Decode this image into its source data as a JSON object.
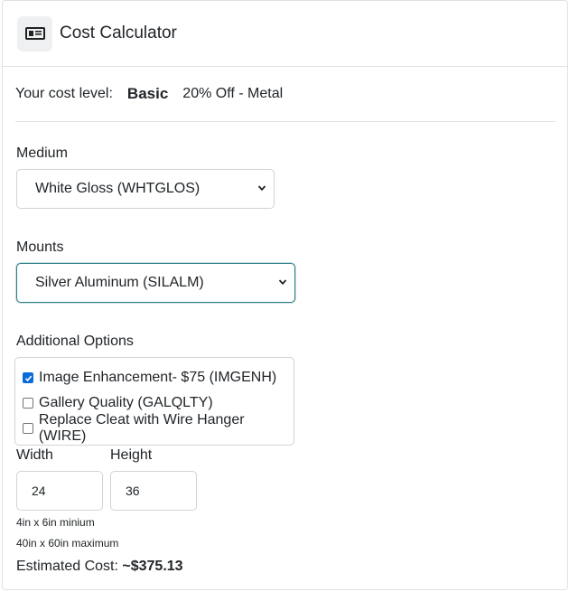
{
  "header": {
    "title": "Cost Calculator",
    "icon": "card-icon"
  },
  "cost_level": {
    "label": "Your cost level:",
    "level": "Basic",
    "discount": "20% Off - Metal"
  },
  "medium": {
    "label": "Medium",
    "selected": "White Gloss (WHTGLOS)"
  },
  "mounts": {
    "label": "Mounts",
    "selected": "Silver Aluminum (SILALM)"
  },
  "additional_options": {
    "label": "Additional Options",
    "items": [
      {
        "label": "Image Enhancement- $75 (IMGENH)",
        "checked": true
      },
      {
        "label": "Gallery Quality (GALQLTY)",
        "checked": false
      },
      {
        "label": "Replace Cleat with Wire Hanger (WIRE)",
        "checked": false
      }
    ]
  },
  "dimensions": {
    "width_label": "Width",
    "width_value": "24",
    "height_label": "Height",
    "height_value": "36",
    "min_note": "4in x 6in minium",
    "max_note": "40in x 60in maximum"
  },
  "estimate": {
    "label": "Estimated Cost:",
    "value": "~$375.13"
  },
  "colors": {
    "accent": "#2f7f86",
    "checkbox": "#0b6cd9",
    "border": "#dfe2e6"
  }
}
